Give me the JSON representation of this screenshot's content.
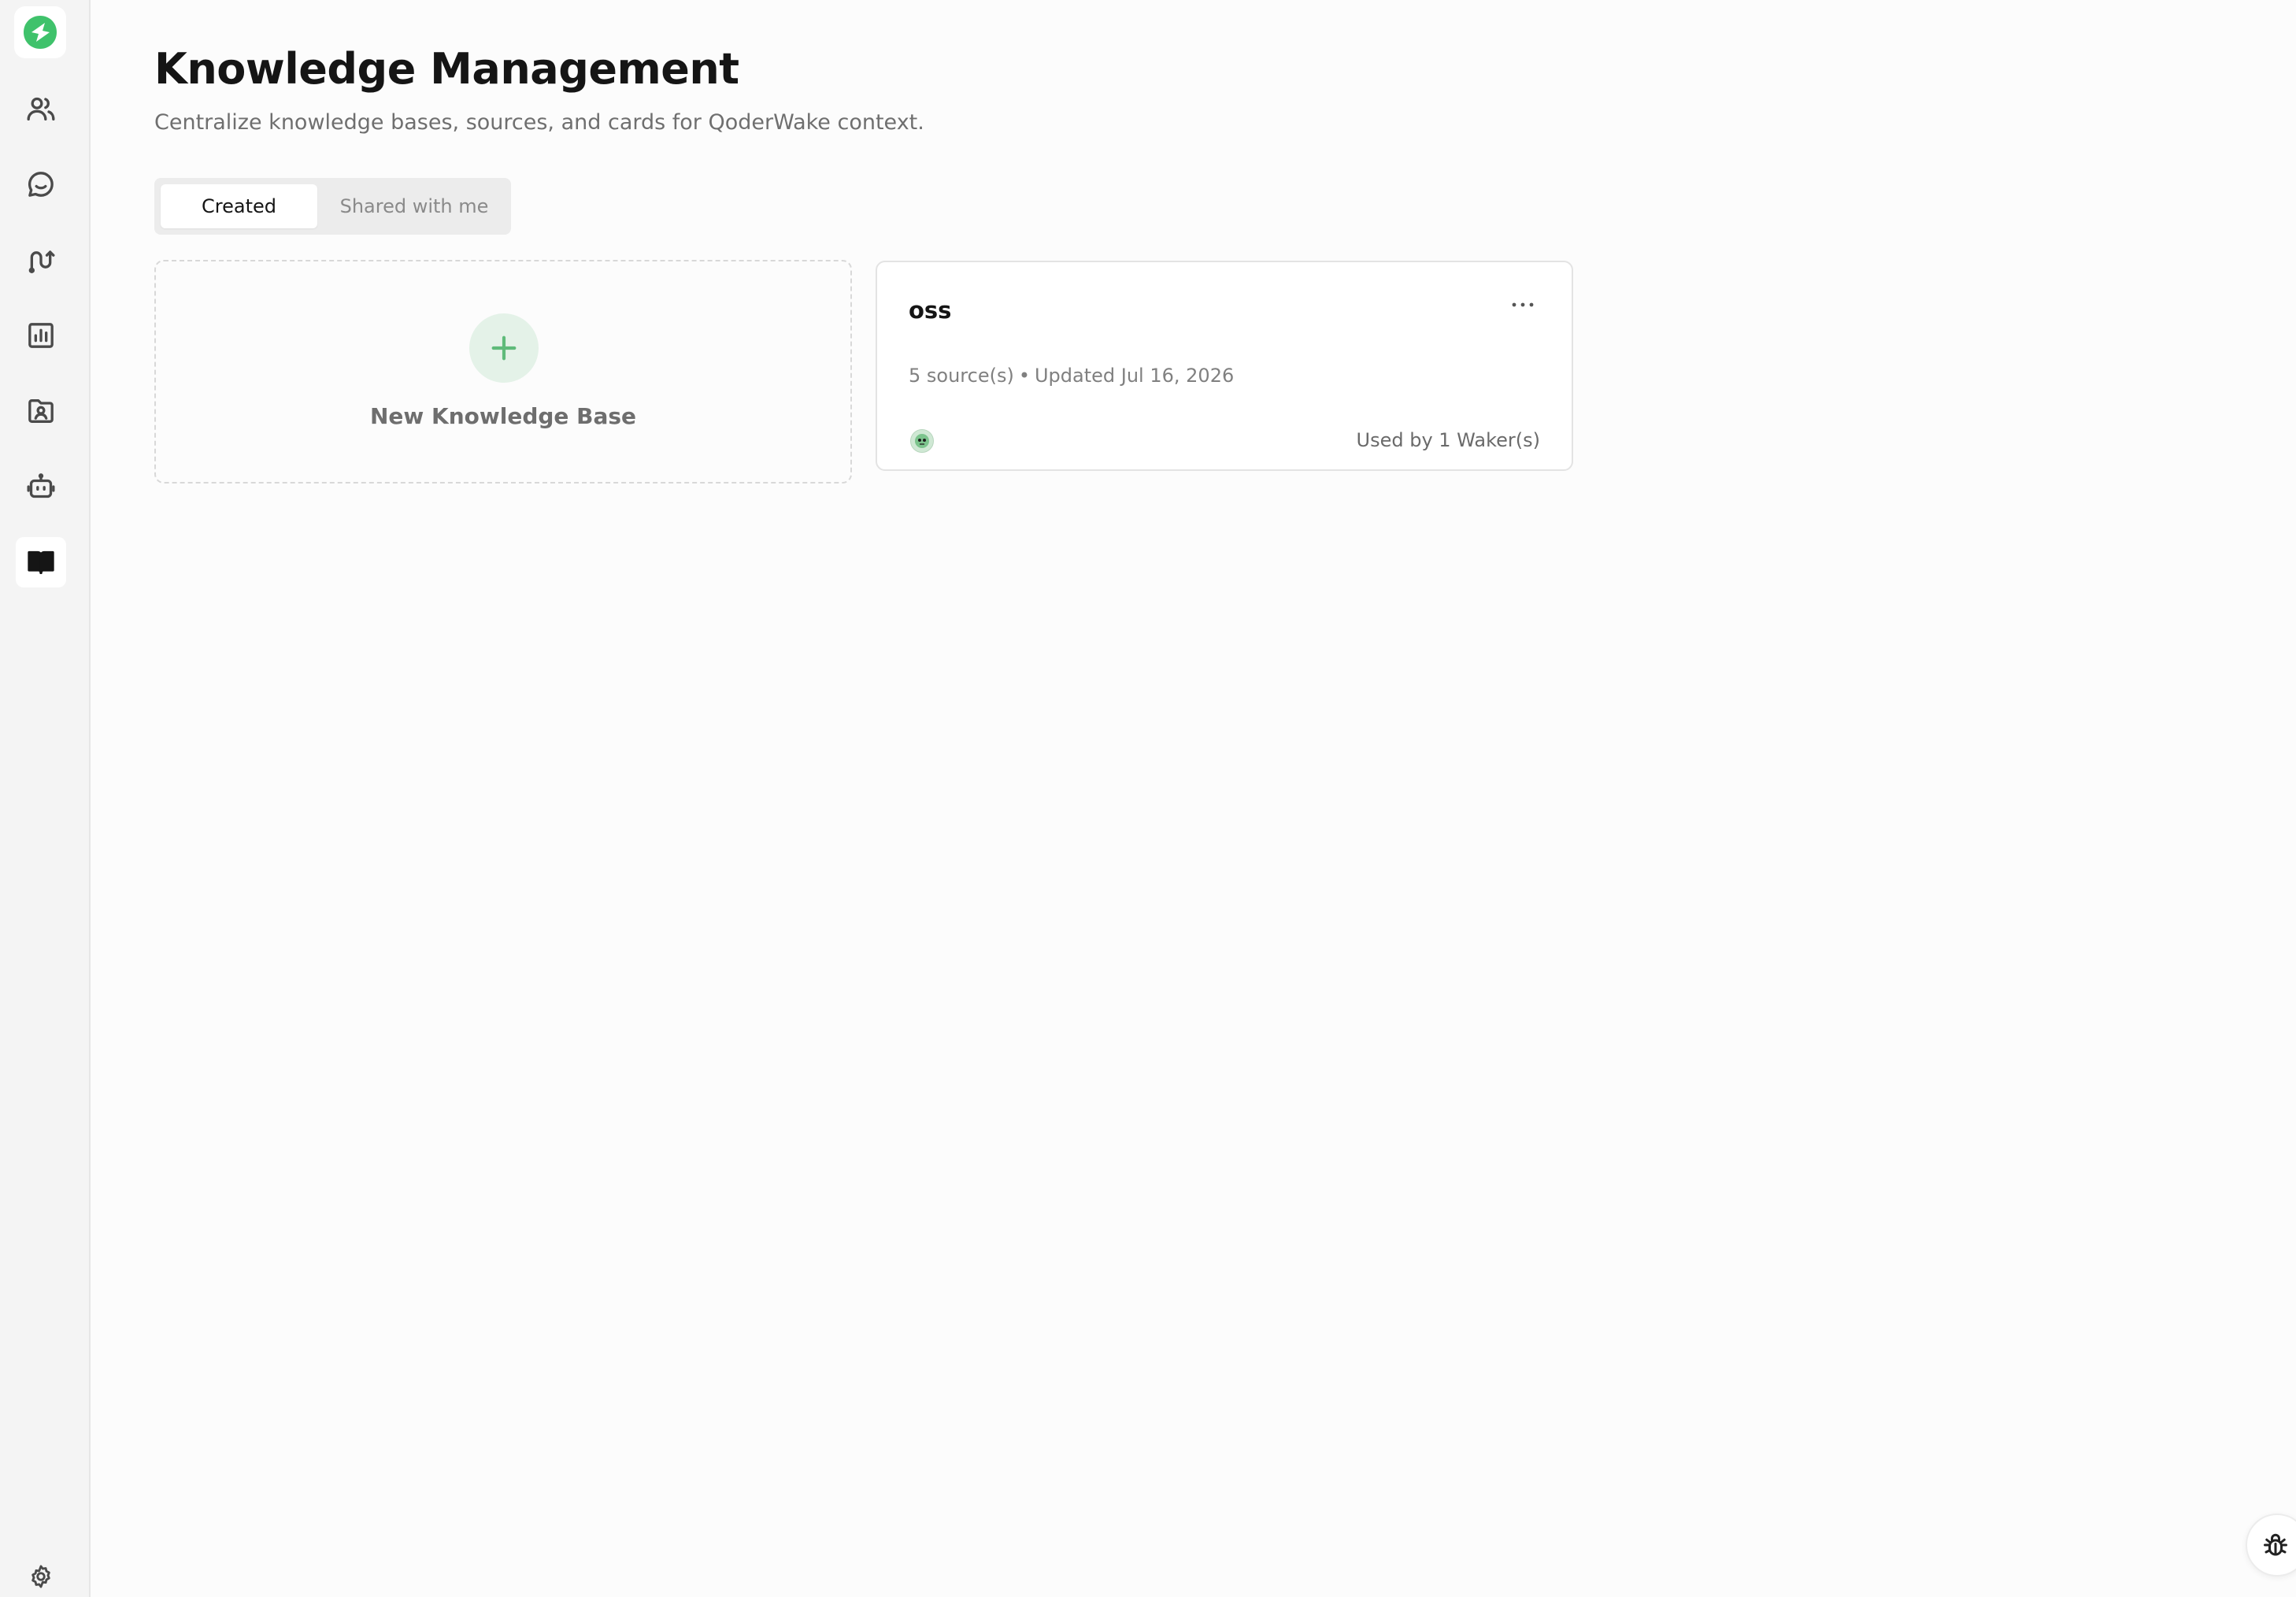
{
  "sidebar": {
    "logo_icon": "qoderwake-logo-icon",
    "items": [
      {
        "icon": "users-icon",
        "active": false
      },
      {
        "icon": "chat-icon",
        "active": false
      },
      {
        "icon": "workflow-icon",
        "active": false
      },
      {
        "icon": "chart-icon",
        "active": false
      },
      {
        "icon": "contact-folder-icon",
        "active": false
      },
      {
        "icon": "robot-icon",
        "active": false
      },
      {
        "icon": "book-icon",
        "active": true
      }
    ],
    "footer_icon": "gear-icon"
  },
  "header": {
    "title": "Knowledge Management",
    "subtitle": "Centralize knowledge bases, sources, and cards for QoderWake context."
  },
  "tabs": [
    {
      "label": "Created",
      "active": true
    },
    {
      "label": "Shared with me",
      "active": false
    }
  ],
  "new_card": {
    "label": "New Knowledge Base",
    "icon": "plus-icon"
  },
  "knowledge_bases": [
    {
      "name": "oss",
      "sources": "5 source(s)",
      "separator": "•",
      "updated": "Updated Jul 16, 2026",
      "used_by": "Used by 1 Waker(s)",
      "menu_icon": "more-horizontal-icon"
    }
  ],
  "debug_button_icon": "bug-icon",
  "colors": {
    "accent": "#3fc26b",
    "sidebar_bg": "#f4f4f4",
    "page_bg": "#fcfcfc"
  }
}
